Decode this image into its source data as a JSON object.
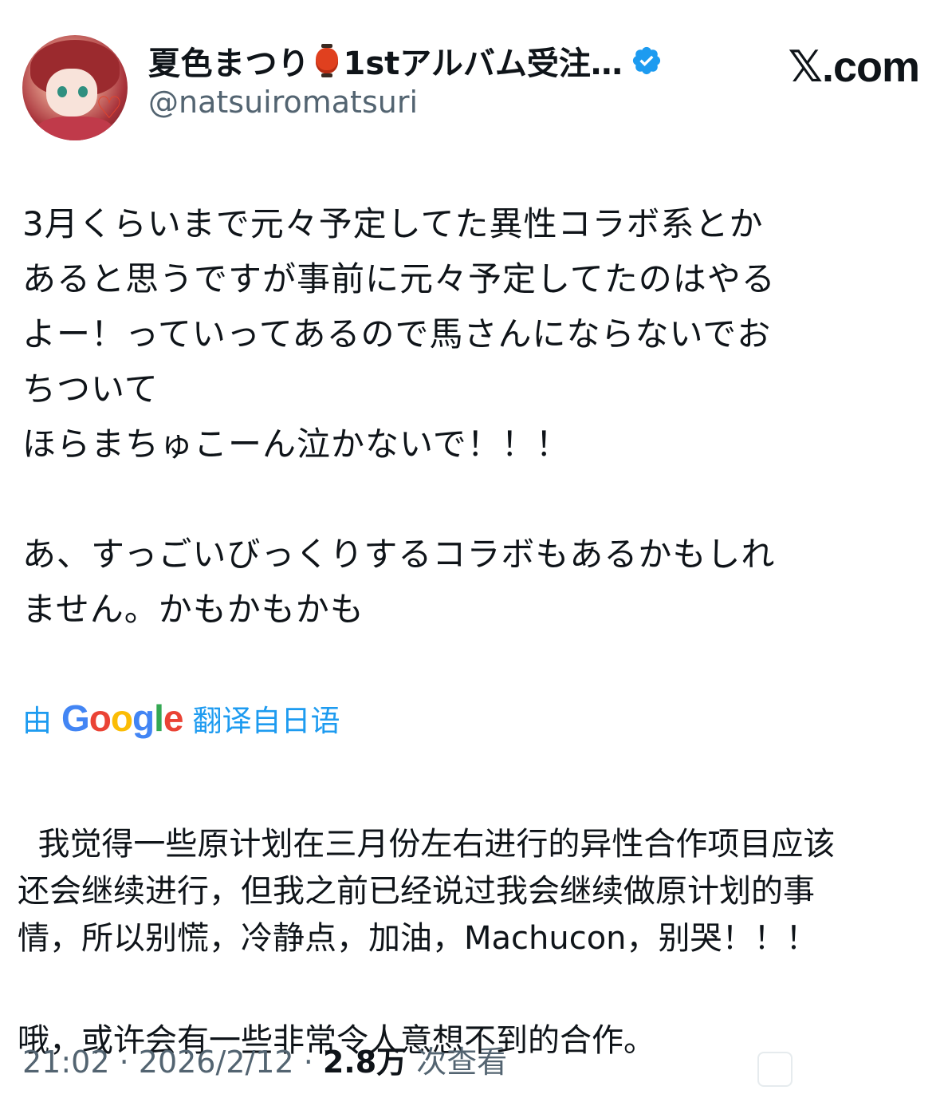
{
  "header": {
    "display_name": "夏色まつり",
    "display_name_suffix": "1stアルバム受注…",
    "lantern_icon": "red-lantern-emoji",
    "verified_icon": "verified-badge-icon",
    "verified_color": "#1d9bf0",
    "handle": "@natsuiromatsuri",
    "site_logo": "𝕏.com"
  },
  "tweet": {
    "text": "3月くらいまで元々予定してた異性コラボ系とか\nあると思うですが事前に元々予定してたのはやる\nよー！っていってあるので馬さんにならないでお\nちついて\nほらまちゅこーん泣かないで！！！\n\nあ、すっごいびっくりするコラボもあるかもしれ\nません。かもかもかも"
  },
  "translation": {
    "prefix": "由",
    "google": [
      "G",
      "o",
      "o",
      "g",
      "l",
      "e"
    ],
    "suffix": "翻译自日语",
    "link_color": "#1d9bf0",
    "text": "我觉得一些原计划在三月份左右进行的异性合作项目应该\n还会继续进行，但我之前已经说过我会继续做原计划的事\n情，所以别慌，冷静点，加油，Machucon，别哭！！！",
    "last_line": "哦，或许会有一些非常令人意想不到的合作。"
  },
  "meta": {
    "time": "21:02",
    "sep1": " · ",
    "date": "2026/2/12",
    "sep2": " · ",
    "views_count": "2.8万",
    "views_label": " 次查看"
  }
}
